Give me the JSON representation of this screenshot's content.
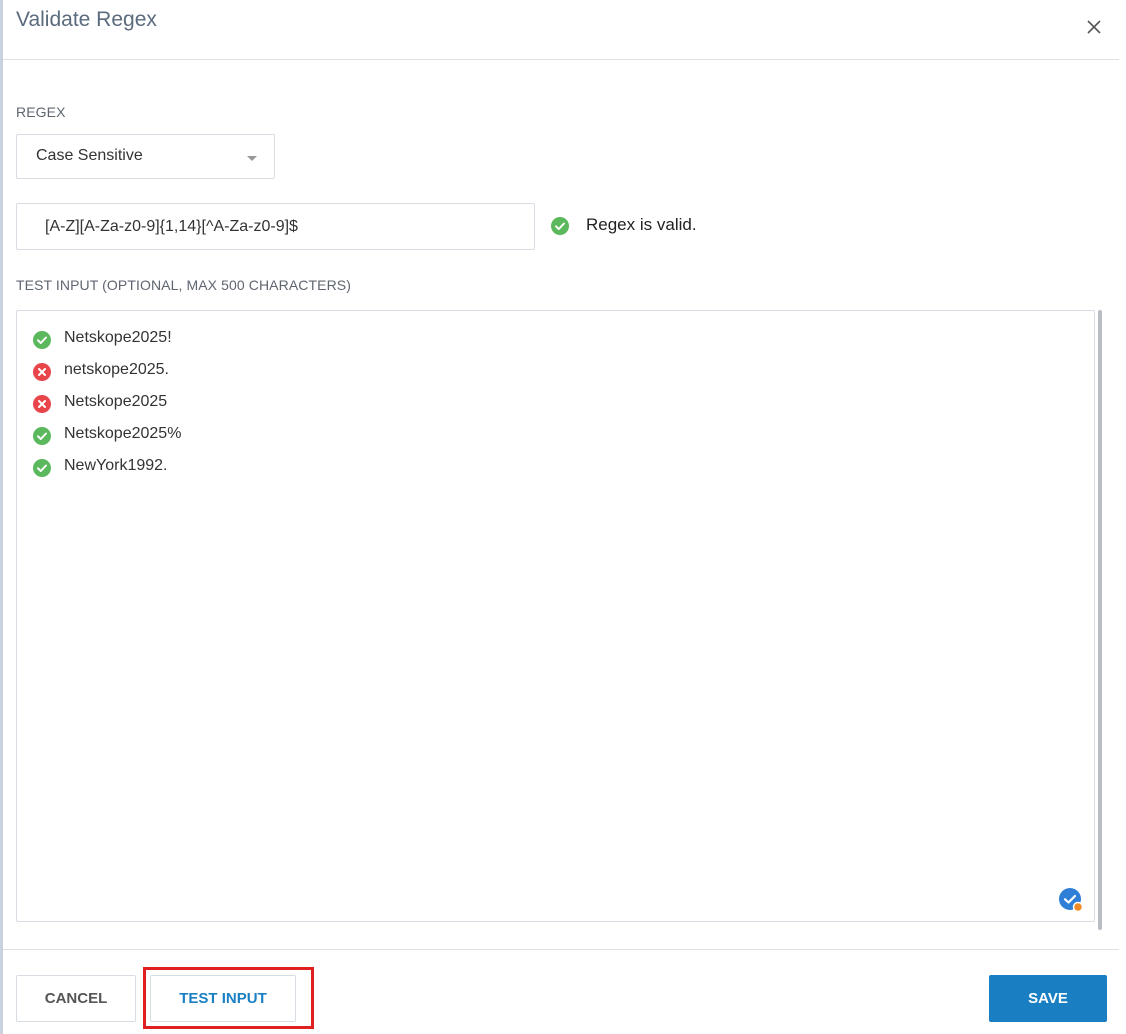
{
  "dialog": {
    "title": "Validate Regex",
    "close_icon": "close-icon"
  },
  "regex": {
    "section_label": "REGEX",
    "case_mode": "Case Sensitive",
    "pattern": "[A-Z][A-Za-z0-9]{1,14}[^A-Za-z0-9]$",
    "status_icon": "check-circle-icon",
    "status_text": "Regex is valid."
  },
  "test_input": {
    "section_label": "TEST INPUT (OPTIONAL, MAX 500 CHARACTERS)",
    "lines": [
      {
        "text": "Netskope2025!",
        "status": "match"
      },
      {
        "text": "netskope2025.",
        "status": "no-match"
      },
      {
        "text": "Netskope2025",
        "status": "no-match"
      },
      {
        "text": "Netskope2025%",
        "status": "match"
      },
      {
        "text": "NewYork1992.",
        "status": "match"
      }
    ]
  },
  "footer": {
    "cancel_label": "CANCEL",
    "test_label": "TEST INPUT",
    "save_label": "SAVE"
  },
  "colors": {
    "accent": "#1a7ec2",
    "match": "#5cb85c",
    "no_match": "#e8464b",
    "highlight": "#e02020"
  }
}
